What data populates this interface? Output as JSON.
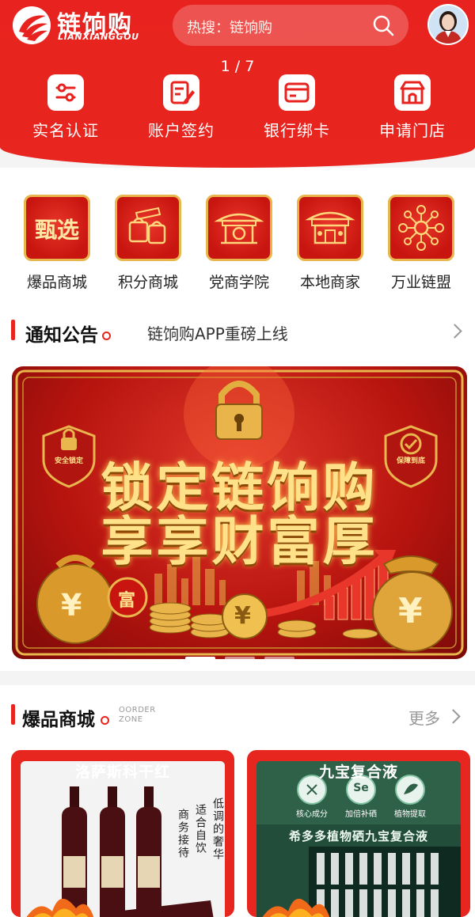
{
  "header": {
    "logo_cn": "链饷购",
    "logo_en": "LIANXIANGGOU",
    "search_text": "热搜：链饷购",
    "pager": "1 / 7"
  },
  "quick_actions": [
    {
      "label": "实名认证",
      "icon": "verify-icon"
    },
    {
      "label": "账户签约",
      "icon": "sign-icon"
    },
    {
      "label": "银行绑卡",
      "icon": "bank-card-icon"
    },
    {
      "label": "申请门店",
      "icon": "store-icon"
    }
  ],
  "categories": [
    {
      "label": "爆品商城",
      "icon_text": "甄选"
    },
    {
      "label": "积分商城",
      "icon": "shopping-bags-icon"
    },
    {
      "label": "党商学院",
      "icon": "pavilion-icon"
    },
    {
      "label": "本地商家",
      "icon": "storefront-icon"
    },
    {
      "label": "万业链盟",
      "icon": "network-icon"
    }
  ],
  "notice": {
    "title": "通知公告",
    "text": "链饷购APP重磅上线"
  },
  "banner": {
    "line1": "锁定链饷购",
    "line2": "享享财富厚",
    "shield_left": "安全锁定",
    "shield_right": "保障到底",
    "bag_glyph": "¥",
    "fu_glyph": "富",
    "coin_glyph": "¥"
  },
  "hot_section": {
    "title": "爆品商城",
    "subtitle_line1": "OORDER",
    "subtitle_line2": "ZONE",
    "more": "更多"
  },
  "products": [
    {
      "title": "洛萨斯科干红",
      "vertical_text": [
        "商务接待",
        "适合自饮",
        "低调的奢华"
      ]
    },
    {
      "title": "九宝复合液",
      "features": [
        "核心成分",
        "加倍补硒",
        "植物提取"
      ],
      "feature_badges": [
        "",
        "Se",
        ""
      ],
      "slogan": "希多多植物硒九宝复合液"
    }
  ],
  "colors": {
    "brand_red": "#e8231f",
    "gold": "#e8b64c"
  }
}
